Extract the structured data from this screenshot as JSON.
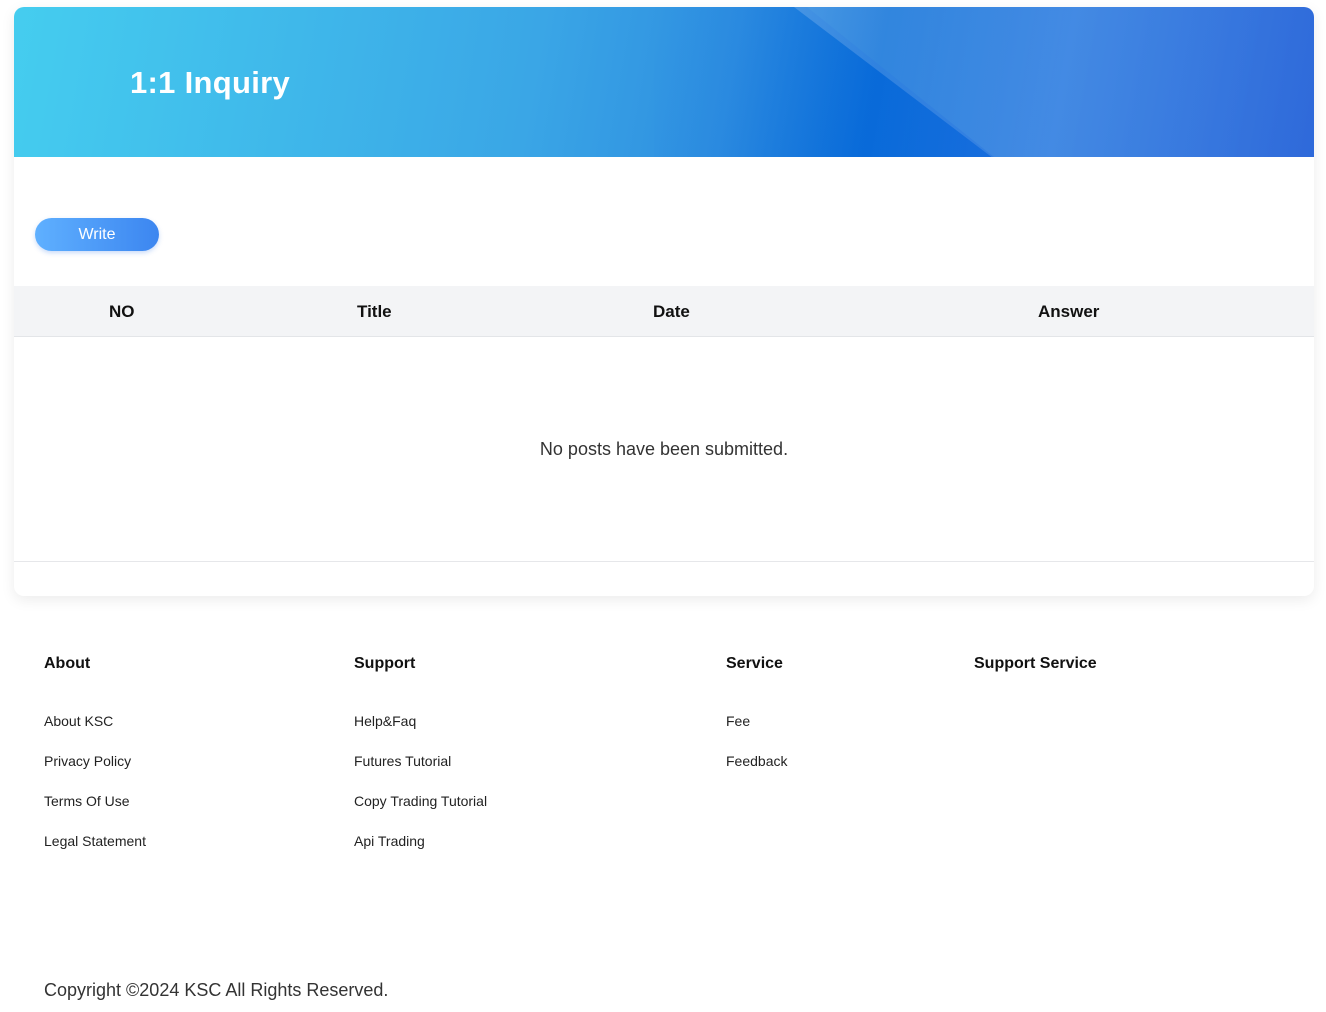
{
  "page": {
    "title": "1:1 Inquiry",
    "write_label": "Write"
  },
  "table": {
    "columns": [
      "NO",
      "Title",
      "Date",
      "Answer"
    ],
    "rows": [],
    "empty_message": "No posts have been submitted."
  },
  "footer": {
    "columns": [
      {
        "heading": "About",
        "links": [
          "About KSC",
          "Privacy Policy",
          "Terms Of Use",
          "Legal Statement"
        ]
      },
      {
        "heading": "Support",
        "links": [
          "Help&Faq",
          "Futures Tutorial",
          "Copy Trading Tutorial",
          "Api Trading"
        ]
      },
      {
        "heading": "Service",
        "links": [
          "Fee",
          "Feedback"
        ]
      },
      {
        "heading": "Support Service",
        "links": []
      }
    ],
    "copyright": "Copyright ©2024 KSC All Rights Reserved."
  },
  "colors": {
    "banner_start": "#45cdef",
    "banner_end": "#2361d8",
    "button_start": "#5fb0ff",
    "button_end": "#3c86f0",
    "table_header_bg": "#f3f4f6"
  }
}
